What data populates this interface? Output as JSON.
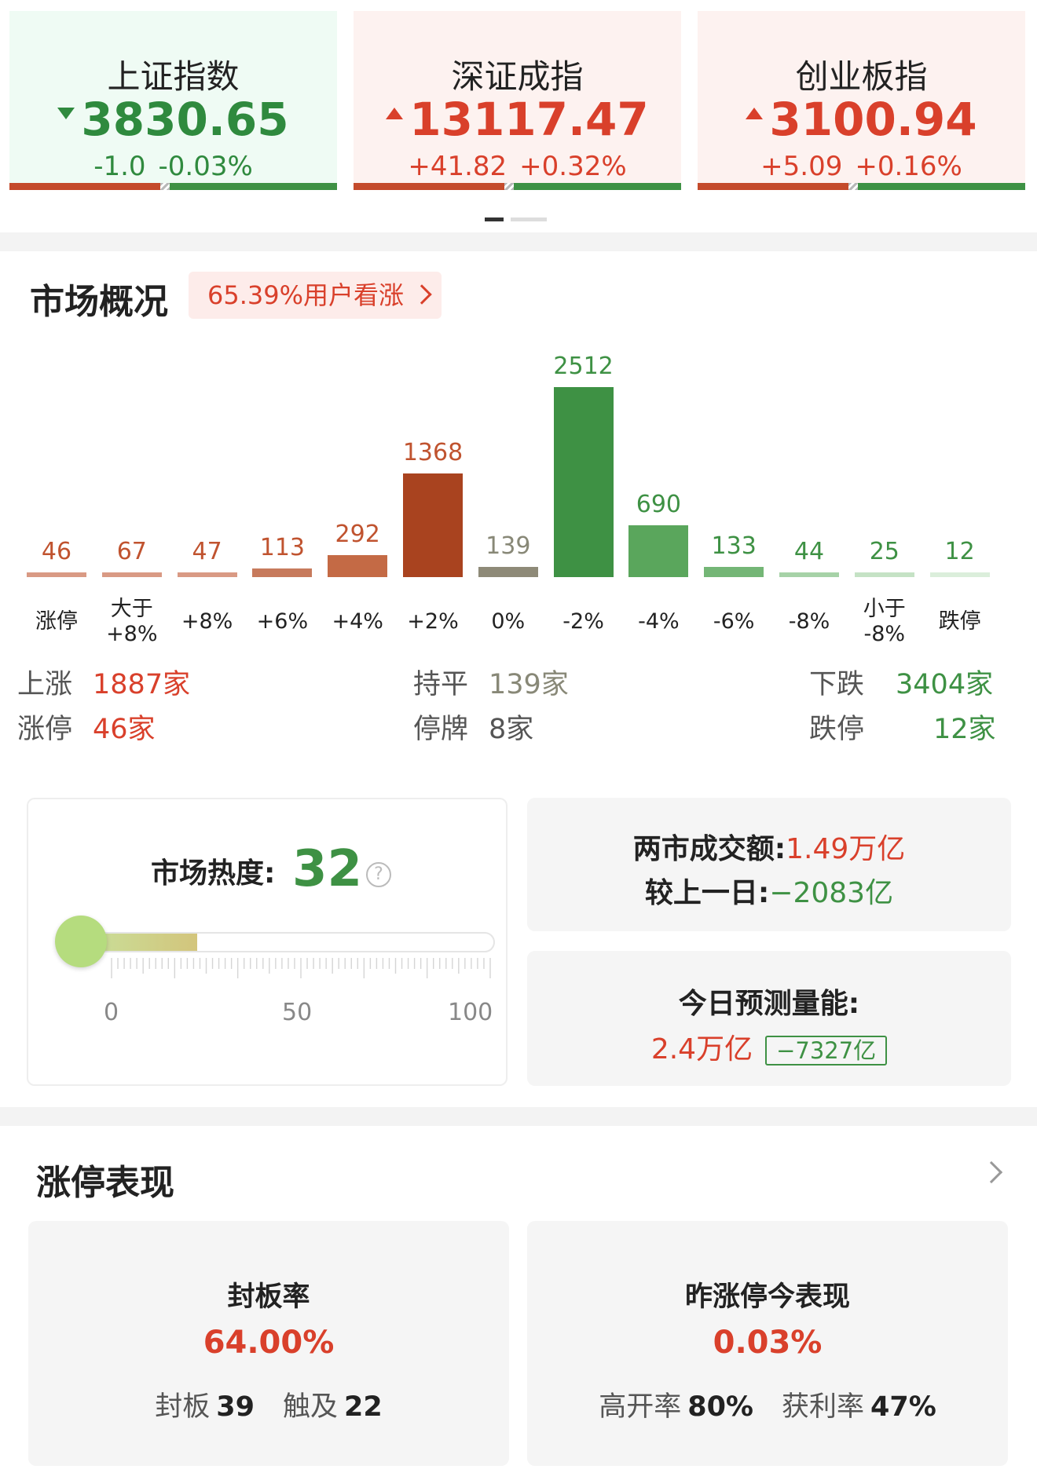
{
  "indices": [
    {
      "name": "上证指数",
      "value": "3830.65",
      "change": "-1.0",
      "change_pct": "-0.03%",
      "direction": "down"
    },
    {
      "name": "深证成指",
      "value": "13117.47",
      "change": "+41.82",
      "change_pct": "+0.32%",
      "direction": "up"
    },
    {
      "name": "创业板指",
      "value": "3100.94",
      "change": "+5.09",
      "change_pct": "+0.16%",
      "direction": "up"
    }
  ],
  "market": {
    "title": "市场概况",
    "sentiment": "65.39%用户看涨"
  },
  "chart_data": {
    "type": "bar",
    "categories": [
      "涨停",
      "大于\n+8%",
      "+8%",
      "+6%",
      "+4%",
      "+2%",
      "0%",
      "-2%",
      "-4%",
      "-6%",
      "-8%",
      "小于\n-8%",
      "跌停"
    ],
    "values": [
      46,
      67,
      47,
      113,
      292,
      1368,
      139,
      2512,
      690,
      133,
      44,
      25,
      12
    ],
    "colors": [
      "#d99a84",
      "#d99a84",
      "#d99a84",
      "#c77a5c",
      "#c46a45",
      "#a9431f",
      "#8e8a78",
      "#3e9144",
      "#5aa65c",
      "#74b676",
      "#a6d2a7",
      "#c5e2c5",
      "#dbeedb"
    ],
    "label_colors": [
      "#c0532f",
      "#c0532f",
      "#c0532f",
      "#c0532f",
      "#c0532f",
      "#c0532f",
      "#888877",
      "#3e9144",
      "#3e9144",
      "#3e9144",
      "#3e9144",
      "#3e9144",
      "#3e9144"
    ]
  },
  "stats": {
    "up_label": "上涨",
    "up_value": "1887家",
    "flat_label": "持平",
    "flat_value": "139家",
    "down_label": "下跌",
    "down_value": "3404家",
    "limit_up_label": "涨停",
    "limit_up_value": "46家",
    "suspended_label": "停牌",
    "suspended_value": "8家",
    "limit_down_label": "跌停",
    "limit_down_value": "12家"
  },
  "heat": {
    "title": "市场热度:",
    "value": "32",
    "level": 0.32,
    "scale": [
      "0",
      "50",
      "100"
    ],
    "help": "?"
  },
  "volume": {
    "turnover_label": "两市成交额:",
    "turnover_value": "1.49万亿",
    "vs_label": "较上一日:",
    "vs_value": "−2083亿",
    "forecast_label": "今日预测量能:",
    "forecast_value": "2.4万亿",
    "forecast_diff": "−7327亿"
  },
  "limit_up": {
    "title": "涨停表现",
    "seal": {
      "title": "封板率",
      "value": "64.00%",
      "a_label": "封板",
      "a_value": "39",
      "b_label": "触及",
      "b_value": "22"
    },
    "yesterday": {
      "title": "昨涨停今表现",
      "value": "0.03%",
      "a_label": "高开率",
      "a_value": "80%",
      "b_label": "获利率",
      "b_value": "47%"
    }
  },
  "colors": {
    "up": "#d9402b",
    "down": "#3e9144",
    "flat": "#888877"
  }
}
